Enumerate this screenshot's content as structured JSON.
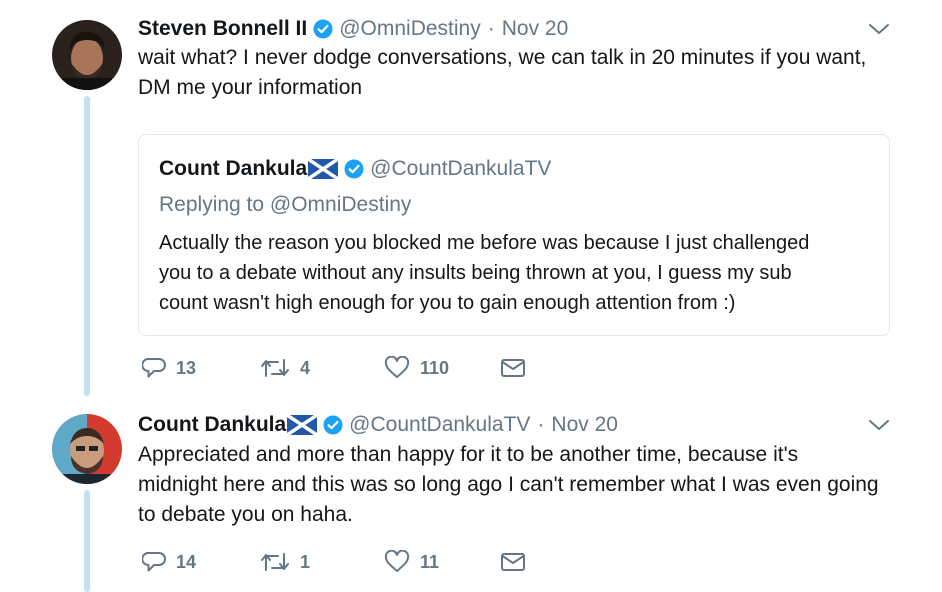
{
  "tweets": [
    {
      "name": "Steven Bonnell II",
      "handle": "@OmniDestiny",
      "separator": "·",
      "date": "Nov 20",
      "text": "wait what? I never dodge conversations, we can talk in 20 minutes if you want,\nDM me your information",
      "quote": {
        "name": "Count Dankula",
        "handle": "@CountDankulaTV",
        "replying_prefix": "Replying to ",
        "replying_to": "@OmniDestiny",
        "text": "Actually the reason you blocked me before was because I just challenged\nyou to a debate without any insults being thrown at you, I guess my sub\ncount wasn't high enough for you to gain enough attention from :)"
      },
      "replies": "13",
      "retweets": "4",
      "likes": "110"
    },
    {
      "name": "Count Dankula",
      "handle": "@CountDankulaTV",
      "separator": "·",
      "date": "Nov 20",
      "text": "Appreciated and more than happy for it to be another time, because it's\nmidnight here and this was so long ago I can't remember what I was even going\nto debate you on haha.",
      "replies": "14",
      "retweets": "1",
      "likes": "11"
    }
  ],
  "colors": {
    "verified": "#1da1f2",
    "thread_line": "#c4e0f7",
    "muted": "#657786",
    "flag_blue": "#2159a8"
  },
  "icons": [
    "verified-badge-icon",
    "scotland-flag-icon",
    "chevron-down-icon",
    "reply-icon",
    "retweet-icon",
    "like-icon",
    "direct-message-icon"
  ]
}
